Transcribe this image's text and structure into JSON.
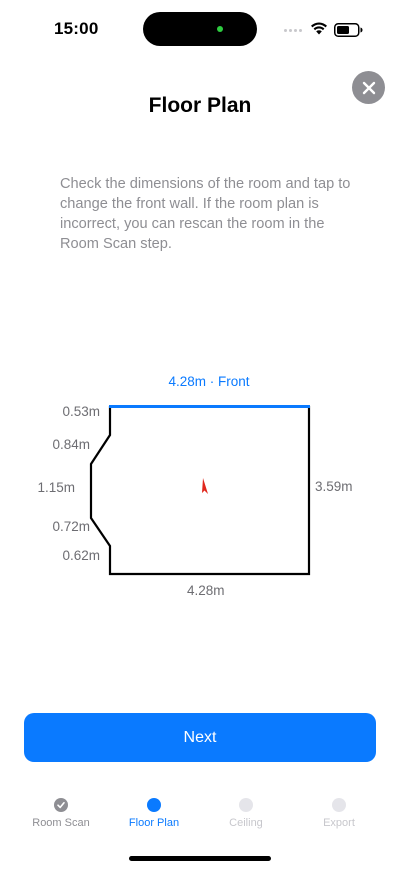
{
  "status_bar": {
    "time": "15:00"
  },
  "title": "Floor Plan",
  "instructions": "Check the dimensions of the room and tap to change the front wall. If the room plan is incorrect, you can rescan the room in the Room Scan step.",
  "floor_plan": {
    "front_label": "4.28m · Front",
    "dimensions": {
      "left_top": "0.53m",
      "left_upper_diagonal": "0.84m",
      "left_middle": "1.15m",
      "left_lower_diagonal": "0.72m",
      "left_bottom": "0.62m",
      "right": "3.59m",
      "bottom": "4.28m"
    },
    "colors": {
      "front_wall": "#0a7aff",
      "walls": "#000000",
      "position_marker": "#e0271d"
    },
    "position_marker_icon": "location-arrow-icon"
  },
  "next_button": {
    "label": "Next"
  },
  "steps": [
    {
      "label": "Room Scan",
      "state": "done"
    },
    {
      "label": "Floor Plan",
      "state": "current"
    },
    {
      "label": "Ceiling",
      "state": "future"
    },
    {
      "label": "Export",
      "state": "future"
    }
  ],
  "accent_color": "#0a7aff"
}
